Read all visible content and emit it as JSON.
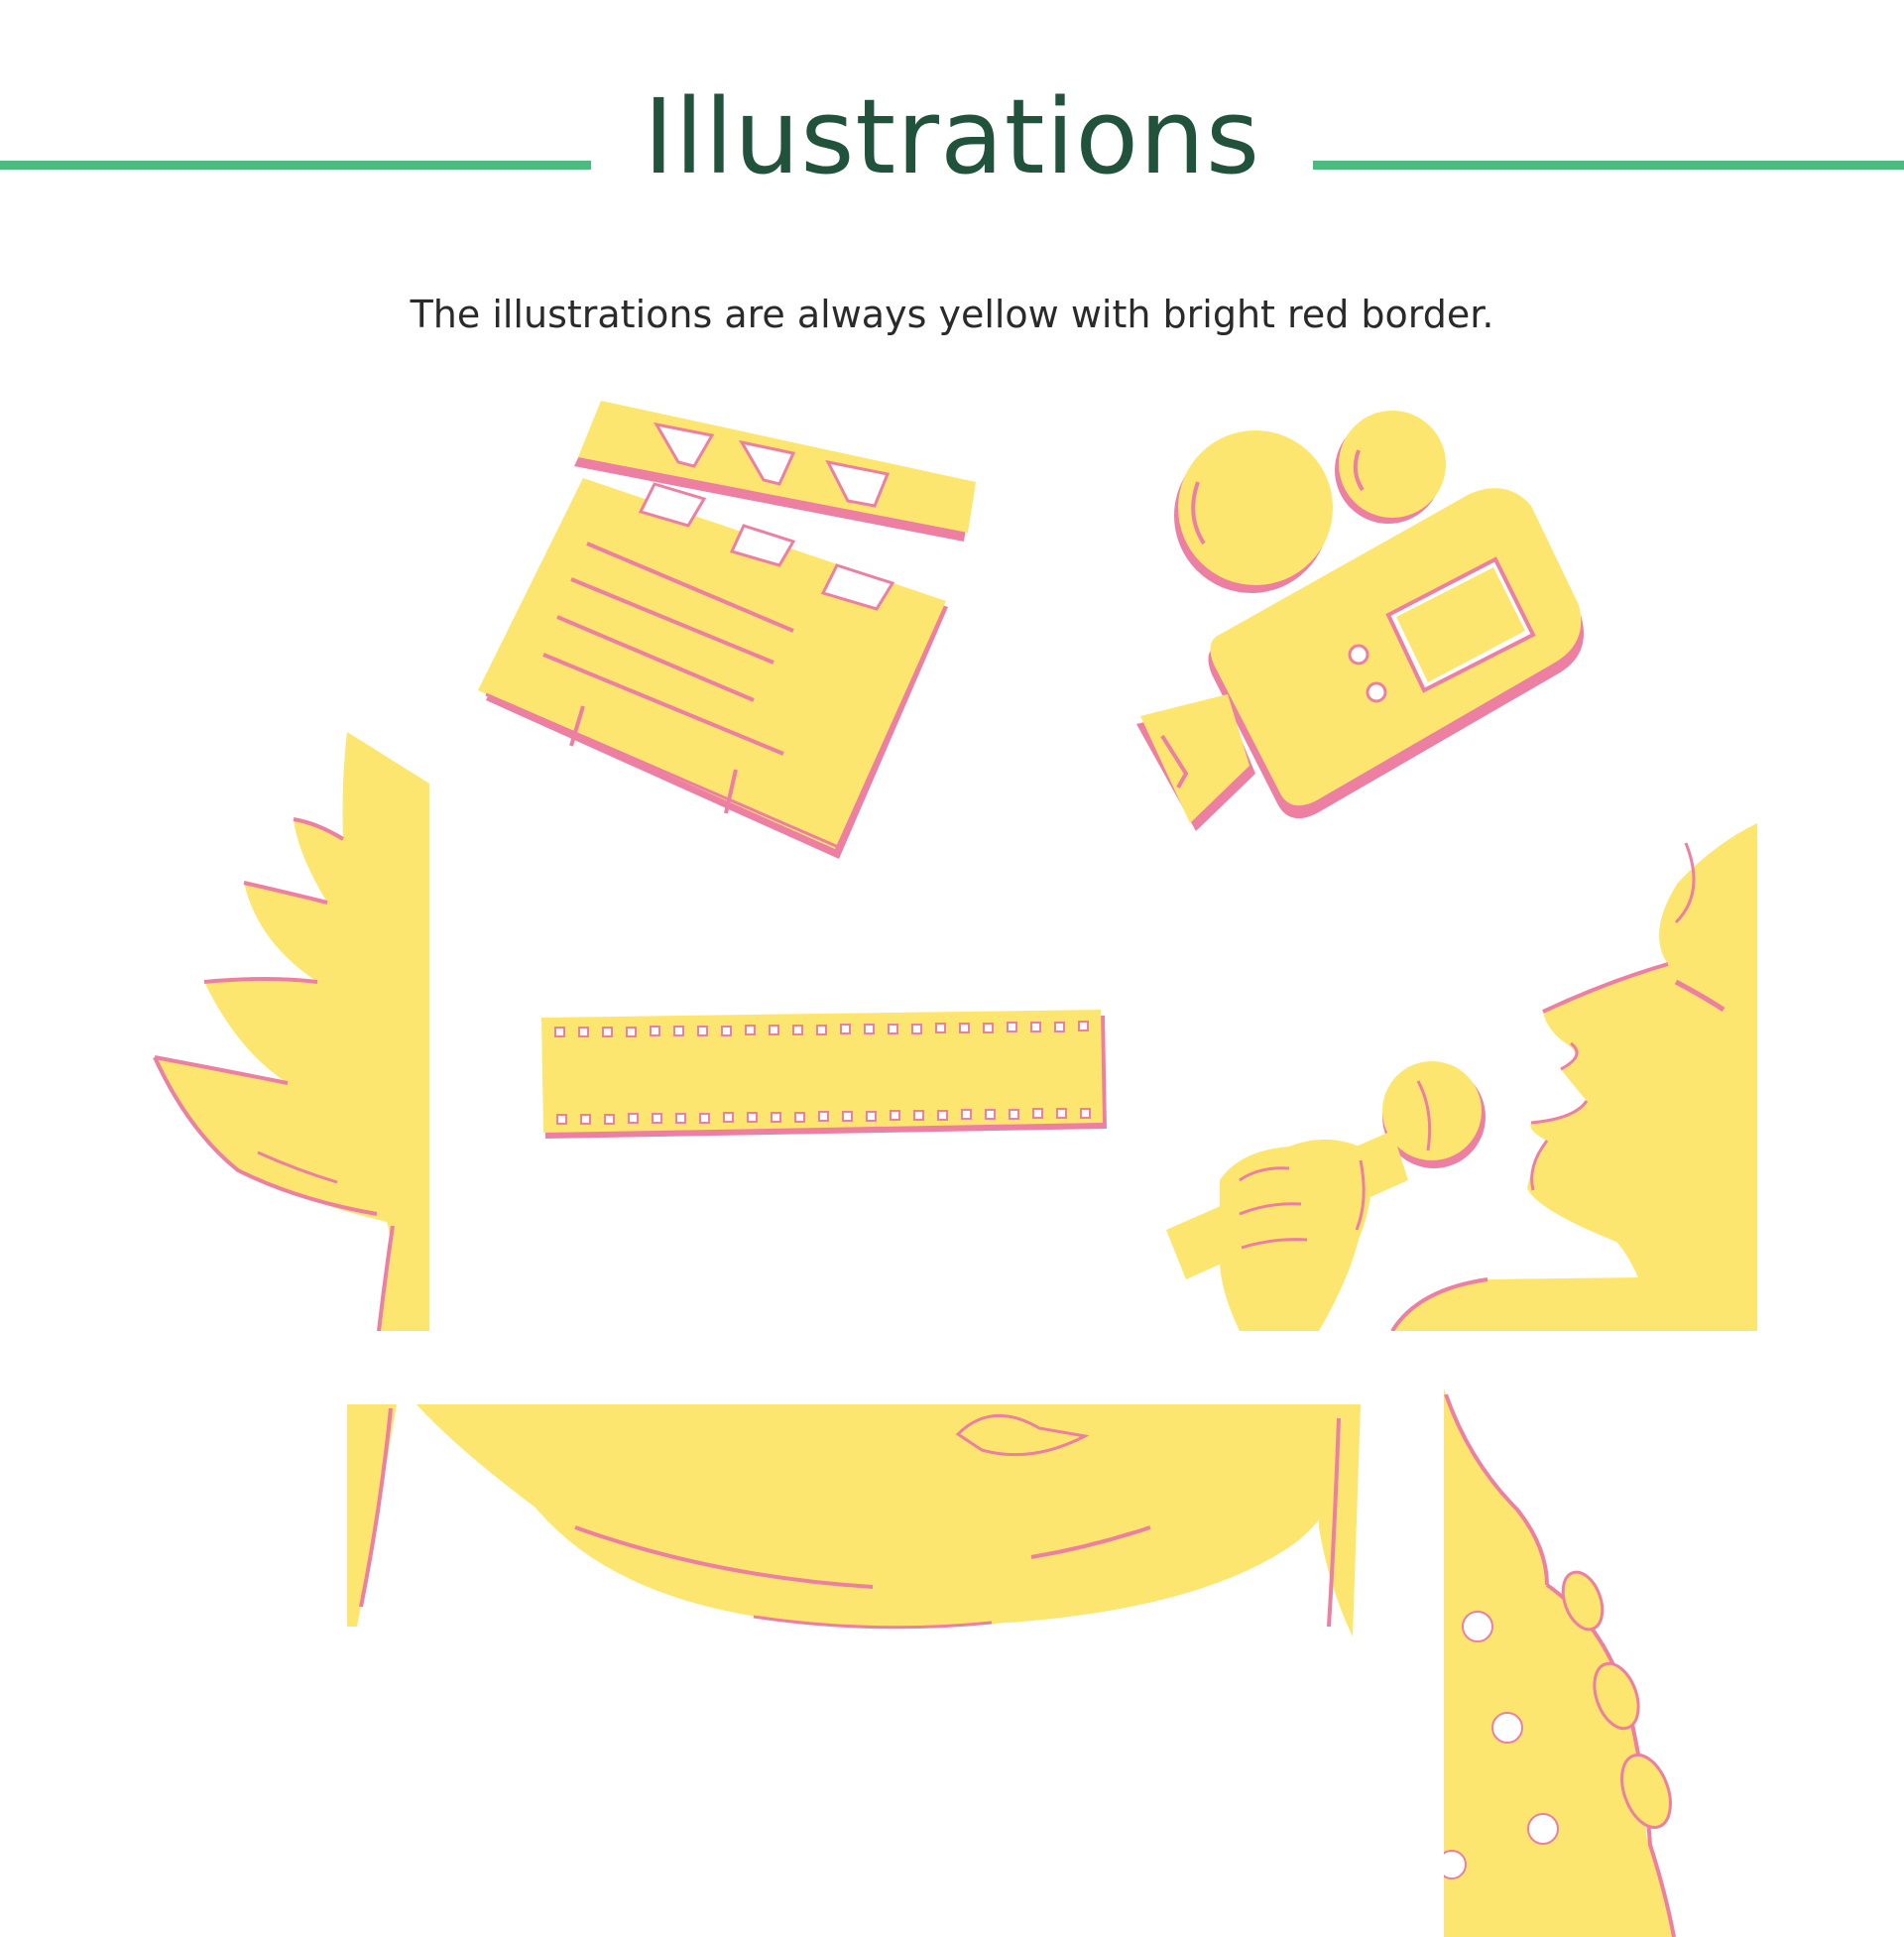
{
  "section": {
    "title": "Illustrations",
    "description": "The illustrations are always yellow with bright red border."
  },
  "colors": {
    "rule": "#4dbb7f",
    "title": "#21533c",
    "fill": "#fde66f",
    "border": "#ec7fa2",
    "text": "#2a2a2a"
  },
  "illustrations": [
    {
      "name": "clapperboard-illustration"
    },
    {
      "name": "film-camera-illustration"
    },
    {
      "name": "film-strip-illustration"
    },
    {
      "name": "palm-leaves-illustration"
    },
    {
      "name": "singer-with-microphone-illustration"
    },
    {
      "name": "stage-curtain-illustration"
    },
    {
      "name": "guitar-headstock-illustration"
    }
  ]
}
